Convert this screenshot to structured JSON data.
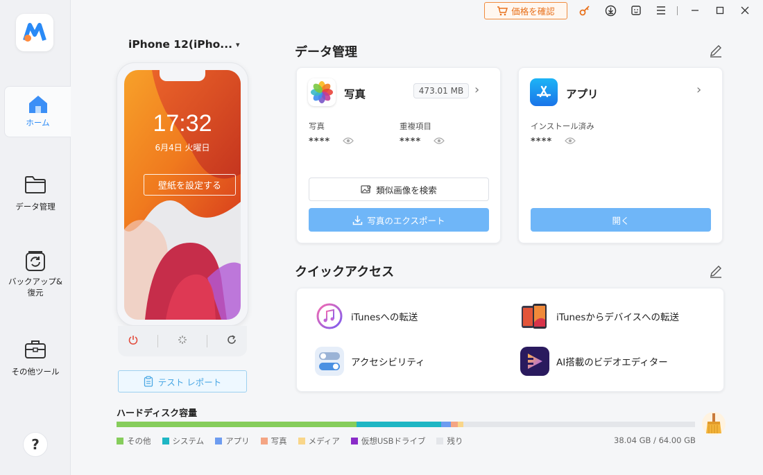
{
  "sidebar": {
    "items": [
      {
        "label": "ホーム",
        "icon": "home-icon",
        "active": true
      },
      {
        "label": "データ管理",
        "icon": "folder-icon"
      },
      {
        "label": "バックアップ&\n復元",
        "label_line1": "バックアップ&",
        "label_line2": "復元",
        "icon": "backup-icon"
      },
      {
        "label": "その他ツール",
        "icon": "toolbox-icon"
      }
    ],
    "help": "?"
  },
  "titlebar": {
    "price_button": "価格を確認"
  },
  "device": {
    "name": "iPhone 12(iPho...",
    "time": "17:32",
    "date": "6月4日 火曜日",
    "wallpaper_button": "壁紙を設定する",
    "test_report": "テスト レポート"
  },
  "data_management": {
    "title": "データ管理",
    "photos": {
      "title": "写真",
      "size": "473.01 MB",
      "stat1_label": "写真",
      "stat1_value": "****",
      "stat2_label": "重複項目",
      "stat2_value": "****",
      "similar_button": "類似画像を検索",
      "export_button": "写真のエクスポート"
    },
    "apps": {
      "title": "アプリ",
      "stat_label": "インストール済み",
      "stat_value": "****",
      "open_button": "開く"
    }
  },
  "quick_access": {
    "title": "クイックアクセス",
    "items": [
      {
        "label": "iTunesへの転送",
        "icon": "itunes-icon"
      },
      {
        "label": "iTunesからデバイスへの転送",
        "icon": "phone-transfer-icon"
      },
      {
        "label": "アクセシビリティ",
        "icon": "toggle-icon"
      },
      {
        "label": "AI搭載のビデオエディター",
        "icon": "video-editor-icon"
      }
    ]
  },
  "disk": {
    "title": "ハードディスク容量",
    "total": "38.04 GB / 64.00 GB",
    "legend": [
      {
        "label": "その他",
        "color": "#86cd5c"
      },
      {
        "label": "システム",
        "color": "#1fb6c4"
      },
      {
        "label": "アプリ",
        "color": "#6d9cf0"
      },
      {
        "label": "写真",
        "color": "#f4a584"
      },
      {
        "label": "メディア",
        "color": "#f9d68a"
      },
      {
        "label": "仮想USBドライブ",
        "color": "#8a2bc8"
      },
      {
        "label": "残り",
        "color": "#e4e6ea"
      }
    ],
    "fractions": [
      0.415,
      0.146,
      0.017,
      0.012,
      0.01,
      0.0,
      0.4
    ]
  },
  "colors": {
    "accent": "#2a8af6",
    "primary_button": "#6fb6f8",
    "price_orange": "#e8711c"
  }
}
